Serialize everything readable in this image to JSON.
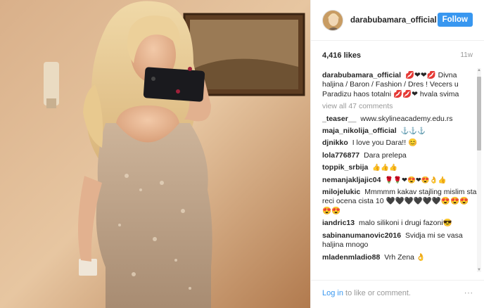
{
  "header": {
    "username": "darabubamara_official",
    "follow_label": "Follow"
  },
  "stats": {
    "likes": "4,416 likes",
    "time_ago": "11w"
  },
  "caption": {
    "username": "darabubamara_official",
    "text": "💋❤❤💋 Divna haljina / Baron / Fashion / Dres ! Vecers u Paradizu haos totalni 💋💋❤ hvala svima"
  },
  "view_all": "view all 47 comments",
  "comments": [
    {
      "user": "_teaser__",
      "text": "www.skylineacademy.edu.rs"
    },
    {
      "user": "maja_nikolija_official",
      "text": "⚓⚓⚓"
    },
    {
      "user": "djnikko",
      "text": "I love you Dara!! 😊"
    },
    {
      "user": "lola776877",
      "text": "Dara prelepa"
    },
    {
      "user": "toppik_srbija",
      "text": "👍👍👍"
    },
    {
      "user": "nemanjakljajic04",
      "text": "🌹🌹❤😍❤😍👌👍"
    },
    {
      "user": "milojelukic",
      "text": "Mmmmm kakav stajling mislim sta reci ocena cista 10 🖤🖤🖤🖤🖤🖤😍😍😍😍😍"
    },
    {
      "user": "iandric13",
      "text": "malo silikoni i drugi fazoni😎"
    },
    {
      "user": "sabinanumanovic2016",
      "text": "Svidja mi se vasa haljina mnogo"
    },
    {
      "user": "mladenmladio88",
      "text": "Vrh Zena 👌"
    }
  ],
  "footer": {
    "login_label": "Log in",
    "rest_label": " to like or comment.",
    "more_label": "∙∙∙"
  },
  "colors": {
    "accent": "#3897f0",
    "muted": "#999999",
    "text": "#262626"
  }
}
